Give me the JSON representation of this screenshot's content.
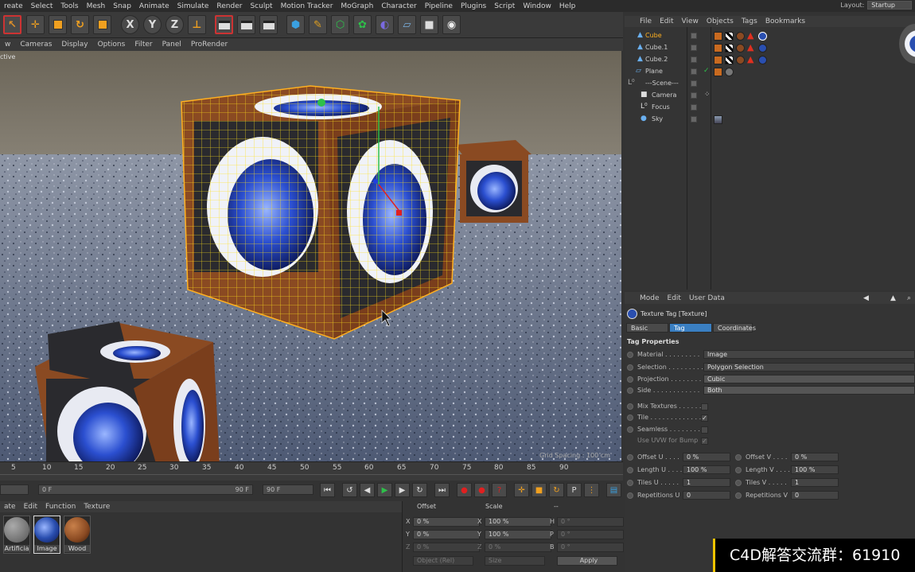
{
  "menu": [
    "reate",
    "Select",
    "Tools",
    "Mesh",
    "Snap",
    "Animate",
    "Simulate",
    "Render",
    "Sculpt",
    "Motion Tracker",
    "MoGraph",
    "Character",
    "Pipeline",
    "Plugins",
    "Script",
    "Window",
    "Help"
  ],
  "layout_label": "Layout:",
  "layout_value": "Startup",
  "toolbar_axes": [
    "X",
    "Y",
    "Z"
  ],
  "viewport_menu": [
    "w",
    "Cameras",
    "Display",
    "Options",
    "Filter",
    "Panel",
    "ProRender"
  ],
  "viewport_label": "ctive",
  "grid_spacing": "Grid Spacing : 100 cm",
  "timeline_ticks": [
    "5",
    "10",
    "15",
    "20",
    "25",
    "30",
    "35",
    "40",
    "45",
    "50",
    "55",
    "60",
    "65",
    "70",
    "75",
    "80",
    "85",
    "90"
  ],
  "time": {
    "start": "0 F",
    "end_slider": "90 F",
    "end": "90 F",
    "current": "0 F"
  },
  "material_menu": [
    "ate",
    "Edit",
    "Function",
    "Texture"
  ],
  "materials": [
    {
      "name": "Artificia",
      "color": "#777"
    },
    {
      "name": "Image",
      "color": "#2a4fb0"
    },
    {
      "name": "Wood",
      "color": "#8a4a22"
    }
  ],
  "coords": {
    "headers": [
      "Offset",
      "Scale",
      "--"
    ],
    "rows": [
      {
        "axis1": "X",
        "v1": "0 %",
        "axis2": "X",
        "v2": "100 %",
        "axis3": "H",
        "v3": "0 °"
      },
      {
        "axis1": "Y",
        "v1": "0 %",
        "axis2": "Y",
        "v2": "100 %",
        "axis3": "P",
        "v3": "0 °"
      },
      {
        "axis1": "Z",
        "v1": "0 %",
        "axis2": "Z",
        "v2": "0 %",
        "axis3": "B",
        "v3": "0 °"
      }
    ],
    "mode": "Object (Rel)",
    "size": "Size",
    "apply": "Apply"
  },
  "om_menu": [
    "File",
    "Edit",
    "View",
    "Objects",
    "Tags",
    "Bookmarks"
  ],
  "objects": [
    {
      "name": "Cube",
      "selected": true
    },
    {
      "name": "Cube.1",
      "selected": false
    },
    {
      "name": "Cube.2",
      "selected": false
    },
    {
      "name": "Plane",
      "selected": false
    },
    {
      "name": "---Scene---",
      "selected": false
    },
    {
      "name": "Camera",
      "selected": false
    },
    {
      "name": "Focus",
      "selected": false
    },
    {
      "name": "Sky",
      "selected": false
    }
  ],
  "am_menu": [
    "Mode",
    "Edit",
    "User Data"
  ],
  "am_title": "Texture Tag [Texture]",
  "tabs": [
    "Basic",
    "Tag",
    "Coordinates"
  ],
  "tag_properties": "Tag Properties",
  "props": [
    {
      "label": "Material . . . . . . . . .",
      "value": "Image"
    },
    {
      "label": "Selection . . . . . . . . .",
      "value": "Polygon Selection"
    },
    {
      "label": "Projection . . . . . . . .",
      "value": "Cubic"
    },
    {
      "label": "Side . . . . . . . . . . . .",
      "value": "Both"
    }
  ],
  "checks": [
    {
      "label": "Mix Textures . . . . . .",
      "value": ""
    },
    {
      "label": "Tile . . . . . . . . . . . . .",
      "value": "✓"
    },
    {
      "label": "Seamless . . . . . . . . .",
      "value": ""
    },
    {
      "label": "Use UVW for Bump",
      "value": "✓"
    }
  ],
  "numeric": [
    {
      "l1": "Offset U . . . .",
      "v1": "0 %",
      "l2": "Offset V . . . .",
      "v2": "0 %"
    },
    {
      "l1": "Length U . . . .",
      "v1": "100 %",
      "l2": "Length V . . . .",
      "v2": "100 %"
    },
    {
      "l1": "Tiles U . . . . .",
      "v1": "1",
      "l2": "Tiles V . . . . .",
      "v2": "1"
    },
    {
      "l1": "Repetitions U",
      "v1": "0",
      "l2": "Repetitions V",
      "v2": "0"
    }
  ],
  "watermark": "C4D解答交流群：61910"
}
